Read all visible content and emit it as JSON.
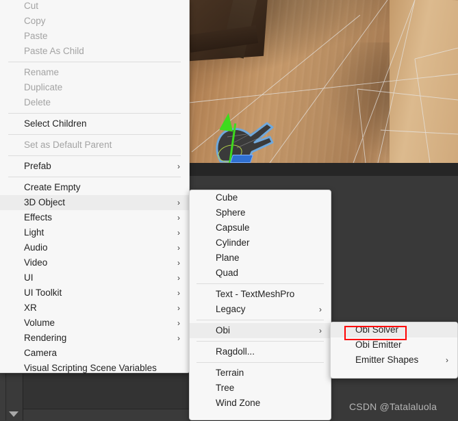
{
  "app": {
    "name": "Unity Editor",
    "watermark": "CSDN @Tatalaluola"
  },
  "scene": {
    "description": "3D scene viewport showing wooden floor with selected hand mesh and green move gizmo"
  },
  "context_menu": {
    "name": "hierarchy-context-menu",
    "groups": [
      {
        "items": [
          {
            "label": "Cut",
            "disabled": true,
            "submenu": false
          },
          {
            "label": "Copy",
            "disabled": true,
            "submenu": false
          },
          {
            "label": "Paste",
            "disabled": true,
            "submenu": false
          },
          {
            "label": "Paste As Child",
            "disabled": true,
            "submenu": false
          }
        ]
      },
      {
        "items": [
          {
            "label": "Rename",
            "disabled": true,
            "submenu": false
          },
          {
            "label": "Duplicate",
            "disabled": true,
            "submenu": false
          },
          {
            "label": "Delete",
            "disabled": true,
            "submenu": false
          }
        ]
      },
      {
        "items": [
          {
            "label": "Select Children",
            "disabled": false,
            "submenu": false
          }
        ]
      },
      {
        "items": [
          {
            "label": "Set as Default Parent",
            "disabled": true,
            "submenu": false
          }
        ]
      },
      {
        "items": [
          {
            "label": "Prefab",
            "disabled": false,
            "submenu": true
          }
        ]
      },
      {
        "items": [
          {
            "label": "Create Empty",
            "disabled": false,
            "submenu": false
          },
          {
            "label": "3D Object",
            "disabled": false,
            "submenu": true,
            "highlighted": true
          },
          {
            "label": "Effects",
            "disabled": false,
            "submenu": true
          },
          {
            "label": "Light",
            "disabled": false,
            "submenu": true
          },
          {
            "label": "Audio",
            "disabled": false,
            "submenu": true
          },
          {
            "label": "Video",
            "disabled": false,
            "submenu": true
          },
          {
            "label": "UI",
            "disabled": false,
            "submenu": true
          },
          {
            "label": "UI Toolkit",
            "disabled": false,
            "submenu": true
          },
          {
            "label": "XR",
            "disabled": false,
            "submenu": true
          },
          {
            "label": "Volume",
            "disabled": false,
            "submenu": true
          },
          {
            "label": "Rendering",
            "disabled": false,
            "submenu": true
          },
          {
            "label": "Camera",
            "disabled": false,
            "submenu": false
          },
          {
            "label": "Visual Scripting Scene Variables",
            "disabled": false,
            "submenu": false
          }
        ]
      }
    ]
  },
  "submenu_3d_object": {
    "name": "3d-object-submenu",
    "groups": [
      {
        "items": [
          {
            "label": "Cube",
            "submenu": false
          },
          {
            "label": "Sphere",
            "submenu": false
          },
          {
            "label": "Capsule",
            "submenu": false
          },
          {
            "label": "Cylinder",
            "submenu": false
          },
          {
            "label": "Plane",
            "submenu": false
          },
          {
            "label": "Quad",
            "submenu": false
          }
        ]
      },
      {
        "items": [
          {
            "label": "Text - TextMeshPro",
            "submenu": false
          },
          {
            "label": "Legacy",
            "submenu": true
          }
        ]
      },
      {
        "items": [
          {
            "label": "Obi",
            "submenu": true,
            "highlighted": true
          }
        ]
      },
      {
        "items": [
          {
            "label": "Ragdoll...",
            "submenu": false
          }
        ]
      },
      {
        "items": [
          {
            "label": "Terrain",
            "submenu": false
          },
          {
            "label": "Tree",
            "submenu": false
          },
          {
            "label": "Wind Zone",
            "submenu": false
          }
        ]
      }
    ]
  },
  "submenu_obi": {
    "name": "obi-submenu",
    "items": [
      {
        "label": "Obi Solver",
        "submenu": false,
        "highlighted": true,
        "outlined": true
      },
      {
        "label": "Obi Emitter",
        "submenu": false
      },
      {
        "label": "Emitter Shapes",
        "submenu": true
      }
    ]
  },
  "icons": {
    "chevron_right": "›"
  },
  "colors": {
    "menu_bg": "#f7f7f7",
    "menu_highlight": "#ececec",
    "editor_bg": "#383838",
    "annotation_red": "#ff0000",
    "gizmo_green": "#3ddb1e",
    "selection_blue": "#6fa8dc"
  }
}
